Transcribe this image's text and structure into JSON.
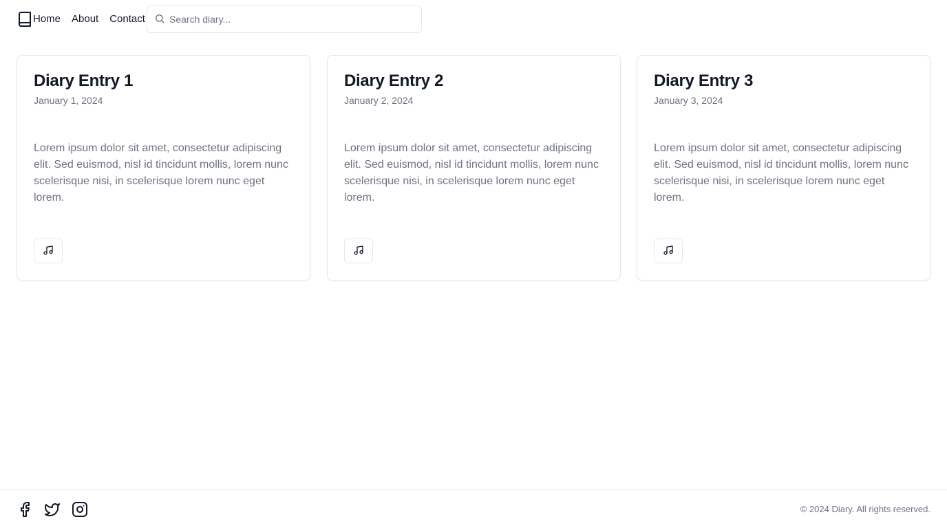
{
  "header": {
    "logo_icon": "book-icon",
    "nav": [
      {
        "label": "Home"
      },
      {
        "label": "About"
      },
      {
        "label": "Contact"
      }
    ],
    "search": {
      "placeholder": "Search diary...",
      "value": "",
      "icon": "search-icon"
    }
  },
  "entries": [
    {
      "title": "Diary Entry 1",
      "date": "January 1, 2024",
      "body": "Lorem ipsum dolor sit amet, consectetur adipiscing elit. Sed euismod, nisl id tincidunt mollis, lorem nunc scelerisque nisi, in scelerisque lorem nunc eget lorem.",
      "button_icon": "music-note-icon"
    },
    {
      "title": "Diary Entry 2",
      "date": "January 2, 2024",
      "body": "Lorem ipsum dolor sit amet, consectetur adipiscing elit. Sed euismod, nisl id tincidunt mollis, lorem nunc scelerisque nisi, in scelerisque lorem nunc eget lorem.",
      "button_icon": "music-note-icon"
    },
    {
      "title": "Diary Entry 3",
      "date": "January 3, 2024",
      "body": "Lorem ipsum dolor sit amet, consectetur adipiscing elit. Sed euismod, nisl id tincidunt mollis, lorem nunc scelerisque nisi, in scelerisque lorem nunc eget lorem.",
      "button_icon": "music-note-icon"
    }
  ],
  "footer": {
    "social": [
      "facebook-icon",
      "twitter-icon",
      "instagram-icon"
    ],
    "copyright": "© 2024 Diary. All rights reserved."
  },
  "colors": {
    "text": "#111827",
    "muted": "#6b7280",
    "border": "#e5e7eb",
    "background": "#ffffff"
  }
}
